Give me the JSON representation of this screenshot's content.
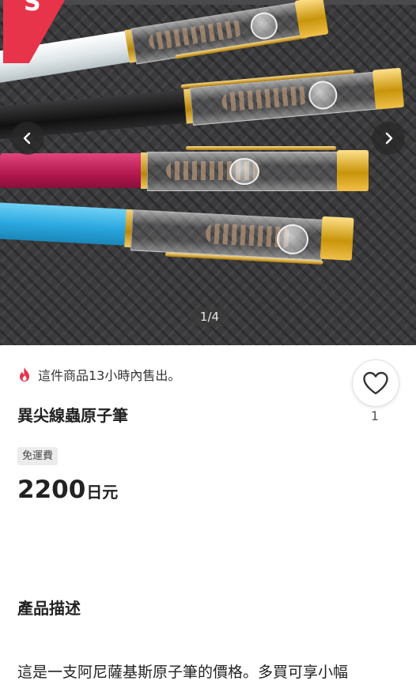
{
  "gallery": {
    "page_indicator": "1/4",
    "prev_icon": "chevron-left-icon",
    "next_icon": "chevron-right-icon",
    "sold_ribbon_icon": "sold-ribbon-icon"
  },
  "sold_notice": {
    "icon": "flame-icon",
    "text": "這件商品13小時內售出。"
  },
  "item": {
    "title": "異尖線蟲原子筆",
    "shipping_badge": "免運費",
    "price_number": "2200",
    "price_unit": "日元"
  },
  "like": {
    "icon": "heart-icon",
    "count": "1"
  },
  "description": {
    "heading": "產品描述",
    "text": "這是一支阿尼薩基斯原子筆的價格。多買可享小幅"
  },
  "colors": {
    "accent": "#e8344b",
    "pen_white": "#e6ecef",
    "pen_black": "#1c1c1e",
    "pen_pink": "#c4205a",
    "pen_blue": "#2aa8e0",
    "gold": "#d4a017"
  }
}
